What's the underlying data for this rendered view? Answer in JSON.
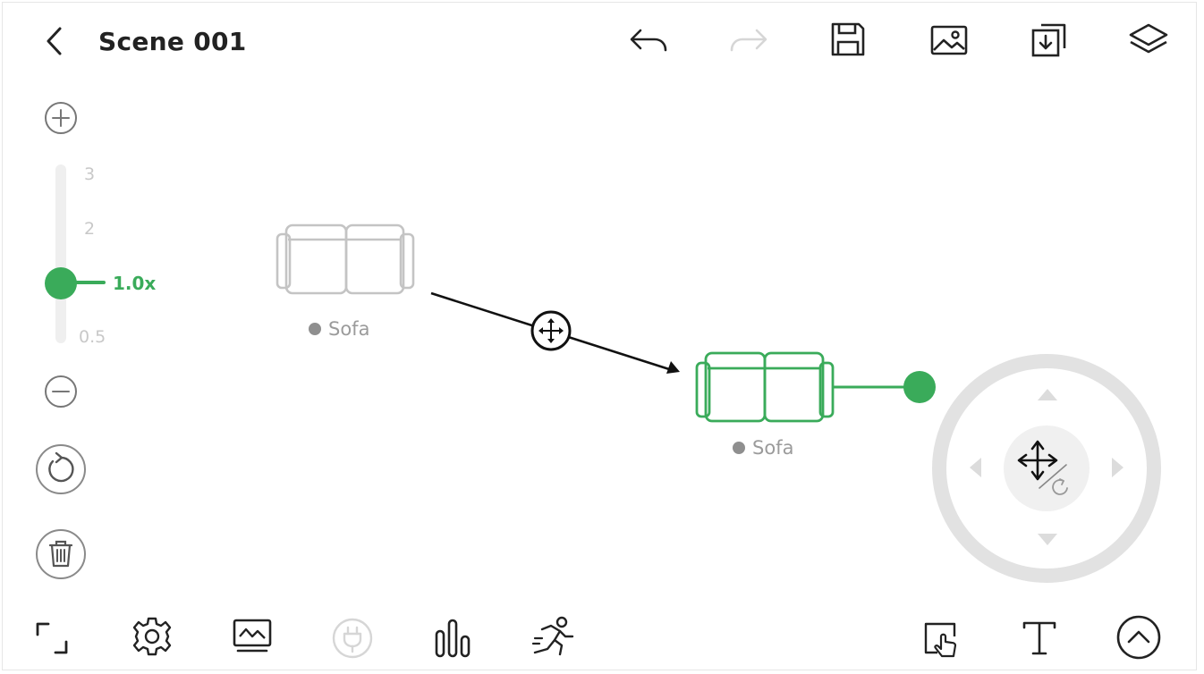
{
  "header": {
    "title": "Scene 001"
  },
  "zoom": {
    "labels": [
      "3",
      "2",
      "0.5"
    ],
    "current": "1.0x",
    "value": 1.0
  },
  "canvas": {
    "objects": [
      {
        "label": "Sofa",
        "state": "original"
      },
      {
        "label": "Sofa",
        "state": "selected"
      }
    ]
  },
  "colors": {
    "accent": "#3aab5a",
    "ghost": "#c4c4c4",
    "disabled": "#d6d6d6",
    "icon": "#222222"
  },
  "icons": {
    "toolbar_top": [
      "back-icon",
      "undo-icon",
      "redo-icon",
      "save-icon",
      "image-icon",
      "import-icon",
      "layers-icon"
    ],
    "toolbar_left": [
      "zoom-in-icon",
      "zoom-out-icon",
      "reset-rotation-icon",
      "delete-icon"
    ],
    "toolbar_bottom": [
      "fit-screen-icon",
      "settings-icon",
      "monitor-icon",
      "plug-icon",
      "chart-icon",
      "run-icon",
      "touch-select-icon",
      "text-icon",
      "collapse-up-icon"
    ],
    "joystick": [
      "move-rotate-icon"
    ]
  }
}
